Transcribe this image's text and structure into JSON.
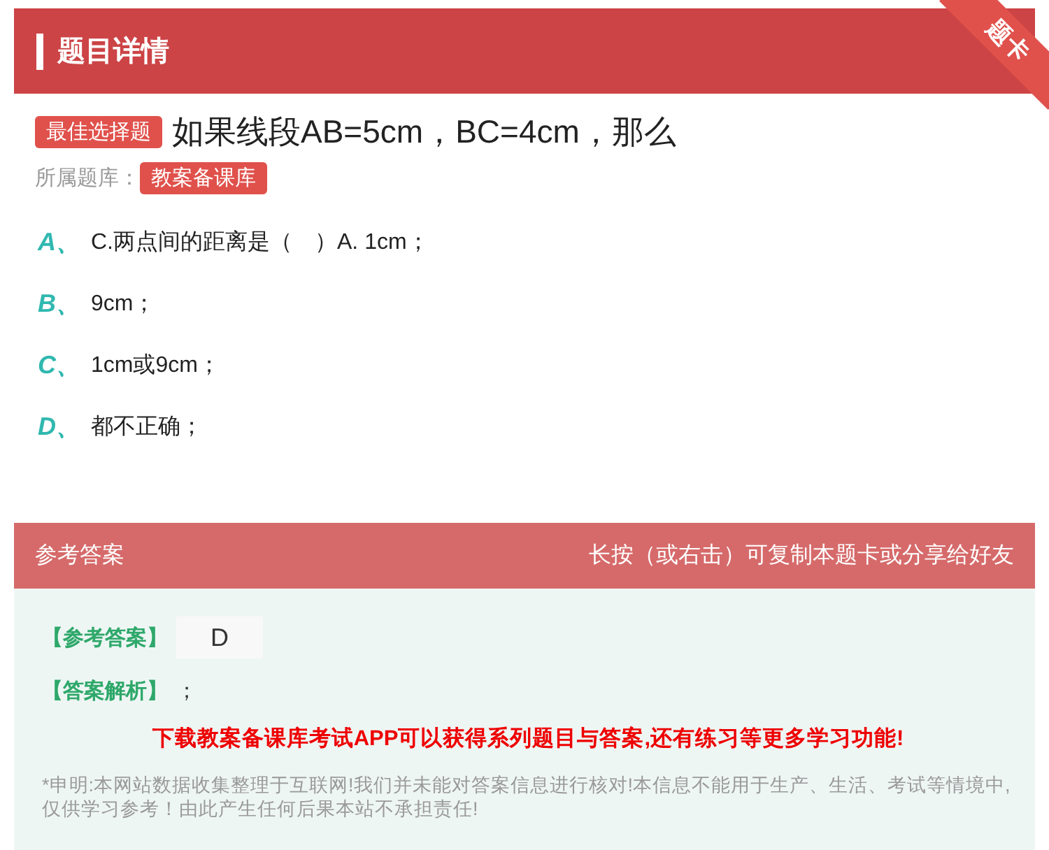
{
  "header": {
    "title": "题目详情",
    "ribbon": "题卡"
  },
  "question": {
    "type_badge": "最佳选择题",
    "text": "如果线段AB=5cm，BC=4cm，那么",
    "bank_label": "所属题库：",
    "bank": "教案备课库"
  },
  "options": [
    {
      "letter": "A、",
      "text": "C.两点间的距离是（　）A. 1cm；"
    },
    {
      "letter": "B、",
      "text": "9cm；"
    },
    {
      "letter": "C、",
      "text": "1cm或9cm；"
    },
    {
      "letter": "D、",
      "text": "都不正确；"
    }
  ],
  "answer": {
    "title": "参考答案",
    "hint": "长按（或右击）可复制本题卡或分享给好友",
    "answer_label": "【参考答案】",
    "answer_value": "D",
    "analysis_label": "【答案解析】",
    "analysis_value": "；",
    "promo": "下载教案备课库考试APP可以获得系列题目与答案,还有练习等更多学习功能!",
    "disclaimer": "*申明:本网站数据收集整理于互联网!我们并未能对答案信息进行核对!本信息不能用于生产、生活、考试等情境中,仅供学习参考！由此产生任何后果本站不承担责任!"
  }
}
